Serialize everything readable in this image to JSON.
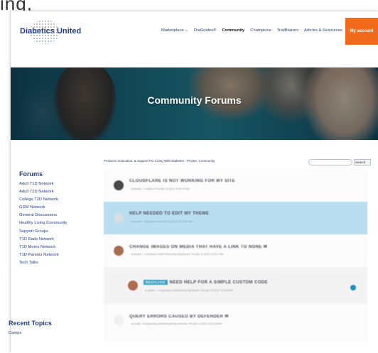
{
  "top_partial_text": "ing,",
  "site": {
    "logo_text": "Diabetics United"
  },
  "nav": {
    "items": [
      "Marketplace ⌄",
      "DiaGuides®",
      "Community",
      "Champions",
      "TrialBlazers",
      "Articles & Resources"
    ],
    "active_index": 2,
    "account_label": "My account"
  },
  "hero": {
    "title": "Community Forums"
  },
  "sidebar": {
    "forums_heading": "Forums",
    "forums": [
      "Adult T1D Network",
      "Adult T2D Network",
      "College T2D Network",
      "GDM Network",
      "General Discussions",
      "Healthy Living Community",
      "Support Groups",
      "T1D Dads Network",
      "T1D Moms Network",
      "T1D Parents Network",
      "Tech Talks"
    ],
    "recent_heading": "Recent Topics",
    "recent": [
      "Camps"
    ]
  },
  "main": {
    "breadcrumb": "Products, Education, & Support For Living With Diabetes › Private: Community",
    "search_placeholder": "",
    "search_button": "Search",
    "topics": [
      {
        "title": "CLOUDFLARE IS NOT WORKING FOR MY SITE",
        "meta": "● Edward · 0 replies ● Thu Apr 11 2019, 10:32:10 AM",
        "highlighted": false,
        "badge": "",
        "avatar_color": "#4a4a4a"
      },
      {
        "title": "HELP NEEDED TO EDIT MY THEME",
        "meta": "● Edward · 1 response ● Thu Apr 11 2019, 10:29:14 AM",
        "highlighted": true,
        "badge": "",
        "avatar_color": "#d7dde2"
      },
      {
        "title": "CHANGE IMAGES ON MEDIA THAT HAVE A LINK TO NONE ✉",
        "meta": "● Edward · 1 response ● Most Recent By Graceful Ali, Thu Apr 11 2019, 2:03:27 AM",
        "highlighted": false,
        "badge": "",
        "avatar_color": "#a76d52"
      },
      {
        "title": "NEED HELP FOR A SIMPLE CUSTOM CODE",
        "meta": "● Quoted · 4 responses ● Most Recent By Ebook, Thu Apr 11 2019, 4:13:45 AM",
        "highlighted": false,
        "badge": "RESOLVED",
        "avatar_color": "#b06b4f"
      },
      {
        "title": "QUERY ERRORS CAUSED BY DEFENDER ✉",
        "meta": "● Scarlet · 8 responses ● Most Recent By Ambuias, Thu Apr 11 2019, 10:18:26 AM",
        "highlighted": false,
        "badge": "",
        "avatar_color": "#f0f0f0"
      }
    ]
  },
  "colors": {
    "brand_blue": "#1f3f8a",
    "accent_orange": "#f26a1b",
    "highlight_row": "#b9def0",
    "badge_blue": "#3aa0c8"
  }
}
